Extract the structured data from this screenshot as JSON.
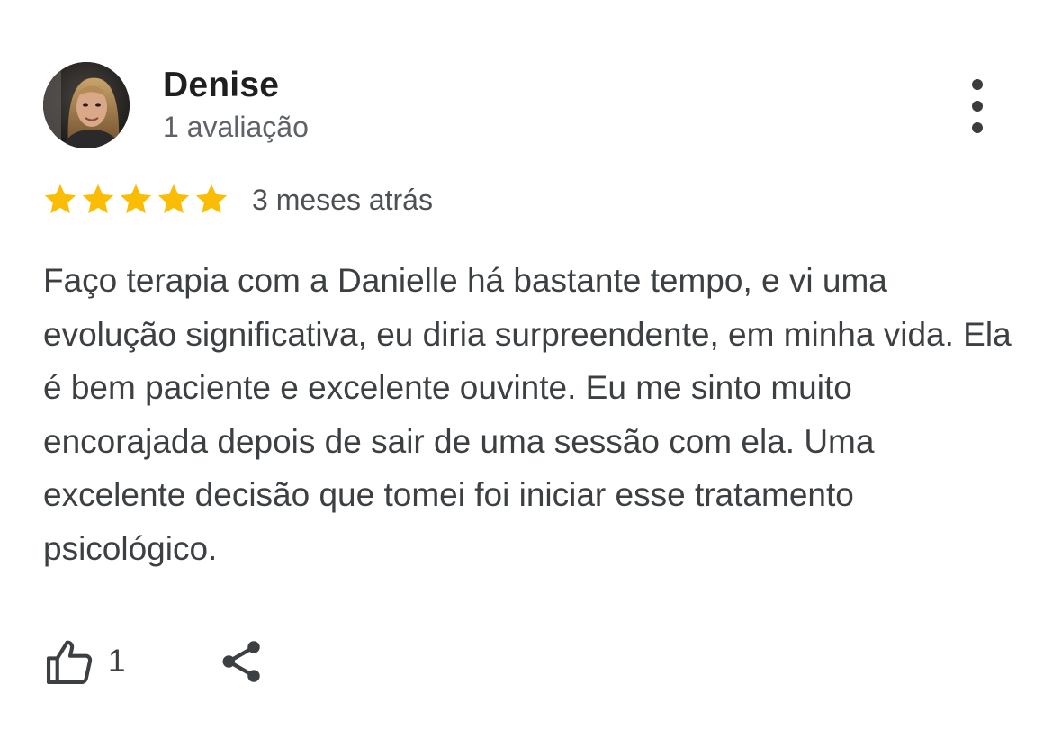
{
  "review": {
    "reviewer_name": "Denise",
    "reviewer_meta": "1 avaliação",
    "rating": 5,
    "rating_max": 5,
    "date": "3 meses atrás",
    "text": "Faço terapia com a Danielle há bastante tempo, e vi uma evolução significativa, eu diria surpreendente, em minha vida. Ela é bem paciente e excelente ouvinte. Eu me sinto muito encorajada depois de sair de uma sessão com ela. Uma excelente decisão que tomei foi iniciar esse tratamento psicológico.",
    "likes": "1"
  },
  "icons": {
    "more": "more-vertical-icon",
    "star": "star-icon",
    "like": "thumbs-up-icon",
    "share": "share-icon"
  },
  "colors": {
    "star": "#FBBC04",
    "text": "#3c4043",
    "secondary": "#5f6368"
  }
}
